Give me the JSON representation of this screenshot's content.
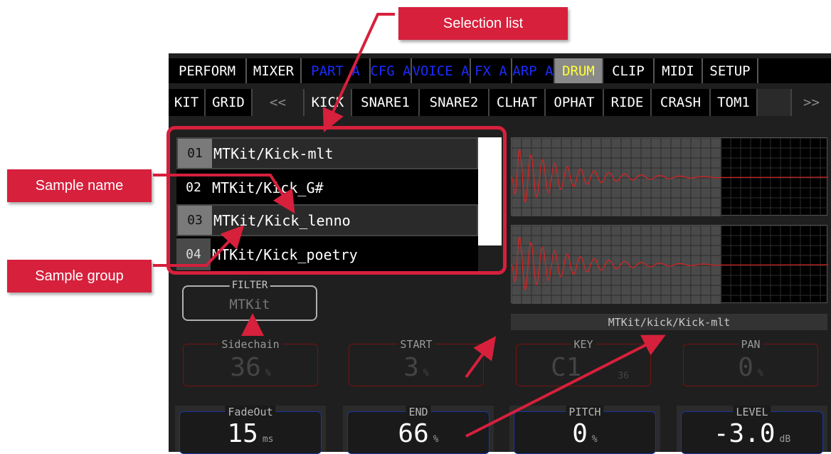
{
  "top_tabs": [
    {
      "label": "PERFORM",
      "style": "white"
    },
    {
      "label": "MIXER",
      "style": "white"
    },
    {
      "label": "PART A",
      "style": "blue"
    },
    {
      "label": "CFG A",
      "style": "blue"
    },
    {
      "label": "VOICE A",
      "style": "blue"
    },
    {
      "label": "FX A",
      "style": "blue"
    },
    {
      "label": "ARP A",
      "style": "blue"
    },
    {
      "label": "DRUM",
      "style": "active"
    },
    {
      "label": "CLIP",
      "style": "white"
    },
    {
      "label": "MIDI",
      "style": "white"
    },
    {
      "label": "SETUP",
      "style": "white"
    }
  ],
  "drum_tabs": [
    {
      "label": "KIT",
      "style": "normal"
    },
    {
      "label": "GRID",
      "style": "normal"
    },
    {
      "label": "<<",
      "style": "dim"
    },
    {
      "label": "KICK",
      "style": "active"
    },
    {
      "label": "SNARE1",
      "style": "normal"
    },
    {
      "label": "SNARE2",
      "style": "normal"
    },
    {
      "label": "CLHAT",
      "style": "normal"
    },
    {
      "label": "OPHAT",
      "style": "normal"
    },
    {
      "label": "RIDE",
      "style": "normal"
    },
    {
      "label": "CRASH",
      "style": "normal"
    },
    {
      "label": "TOM1",
      "style": "normal"
    },
    {
      "label": "",
      "style": "blank"
    },
    {
      "label": ">>",
      "style": "dim"
    }
  ],
  "samples": [
    {
      "num": "01",
      "name": "MTKit/Kick-mlt",
      "selected": true
    },
    {
      "num": "02",
      "name": "MTKit/Kick_G#",
      "selected": false
    },
    {
      "num": "03",
      "name": "MTKit/Kick_lenno",
      "selected": true
    },
    {
      "num": "04",
      "name": "MTKit/Kick_poetry",
      "selected": false
    }
  ],
  "sample_path": "MTKit/kick/Kick-mlt",
  "filter": {
    "title": "FILTER",
    "value": "MTKit"
  },
  "params_row1": {
    "sidechain": {
      "title": "Sidechain",
      "value": "36",
      "unit": "%"
    },
    "start": {
      "title": "START",
      "value": "3",
      "unit": "%"
    },
    "key": {
      "title": "KEY",
      "value": "C1",
      "sub": "36"
    },
    "pan": {
      "title": "PAN",
      "value": "0",
      "unit": "%"
    }
  },
  "params_row2": {
    "fadeout": {
      "title": "FadeOut",
      "value": "15",
      "unit": "ms"
    },
    "end": {
      "title": "END",
      "value": "66",
      "unit": "%"
    },
    "pitch": {
      "title": "PITCH",
      "value": "0",
      "unit": "%"
    },
    "level": {
      "title": "LEVEL",
      "value": "-3.0",
      "unit": "dB"
    }
  },
  "callouts": {
    "selection_list": "Selection list",
    "sample_name": "Sample name",
    "sample_group": "Sample group"
  },
  "colors": {
    "accent_red": "#d6203c",
    "waveform": "#e02020",
    "tab_blue": "#1a2cff",
    "tab_active": "#ffff3a"
  }
}
